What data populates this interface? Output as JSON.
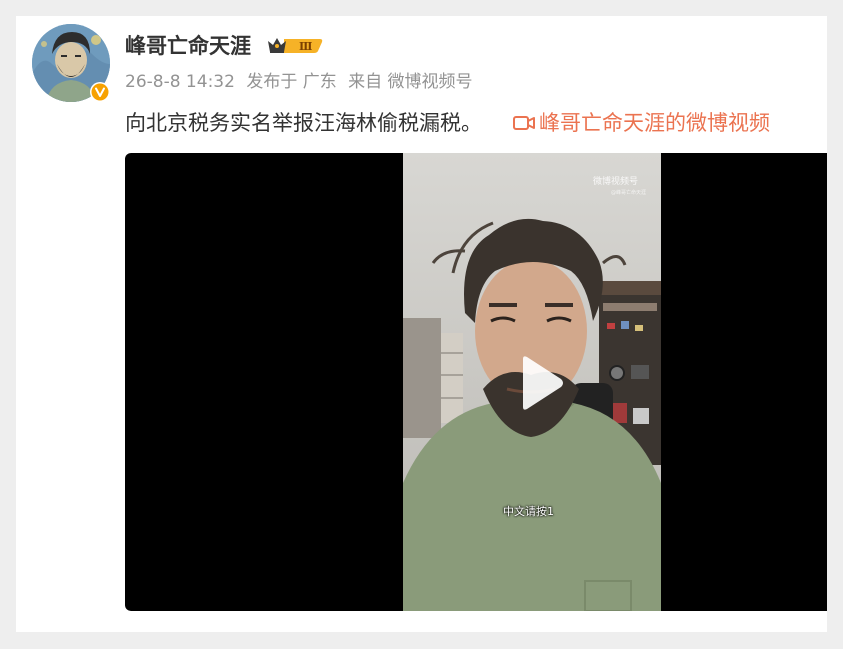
{
  "post": {
    "username": "峰哥亡命天涯",
    "vip_level": "Ⅲ",
    "timestamp": "26-8-8 14:32",
    "published_in": "发布于 广东",
    "source": "来自 微博视频号",
    "text": "向北京税务实名举报汪海林偷税漏税。",
    "video_link_label": "峰哥亡命天涯的微博视频"
  },
  "video": {
    "watermark": "微博视频号",
    "watermark_sub": "@峰哥亡命天涯",
    "subtitle": "中文请按1"
  },
  "colors": {
    "accent_link": "#eb7350",
    "verified_badge": "#f7a100",
    "vip_badge": "#f6b227",
    "text_primary": "#333333",
    "text_meta": "#939393"
  },
  "icons": {
    "verified": "verified-v-icon",
    "vip": "crown-icon",
    "video_link": "video-camera-icon",
    "play": "play-icon"
  }
}
